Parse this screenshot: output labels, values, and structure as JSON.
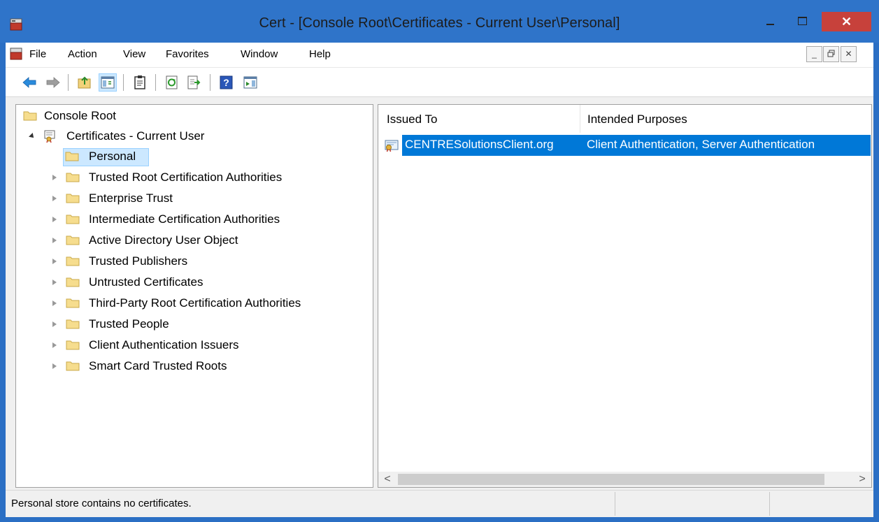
{
  "window": {
    "title": "Cert - [Console Root\\Certificates - Current User\\Personal]",
    "close_glyph": "✕"
  },
  "menu": {
    "items": [
      "File",
      "Action",
      "View",
      "Favorites",
      "Window",
      "Help"
    ]
  },
  "mdi": {
    "minimize_glyph": "_",
    "restore_glyph": "🗗",
    "close_glyph": "✕"
  },
  "tree": {
    "root": "Console Root",
    "store": "Certificates - Current User",
    "children": [
      "Personal",
      "Trusted Root Certification Authorities",
      "Enterprise Trust",
      "Intermediate Certification Authorities",
      "Active Directory User Object",
      "Trusted Publishers",
      "Untrusted Certificates",
      "Third-Party Root Certification Authorities",
      "Trusted People",
      "Client Authentication Issuers",
      "Smart Card Trusted Roots"
    ]
  },
  "list": {
    "columns": [
      "Issued To",
      "Intended Purposes"
    ],
    "rows": [
      {
        "issued_to": "CENTRESolutionsClient.org",
        "purposes": "Client Authentication, Server Authentication"
      }
    ],
    "scroll_left": "<",
    "scroll_right": ">"
  },
  "status": {
    "text": "Personal store contains no certificates."
  },
  "colors": {
    "titlebar": "#2f74c9",
    "close_button": "#c7413b",
    "selection": "#0078d7",
    "tree_selection": "#cce8ff"
  }
}
